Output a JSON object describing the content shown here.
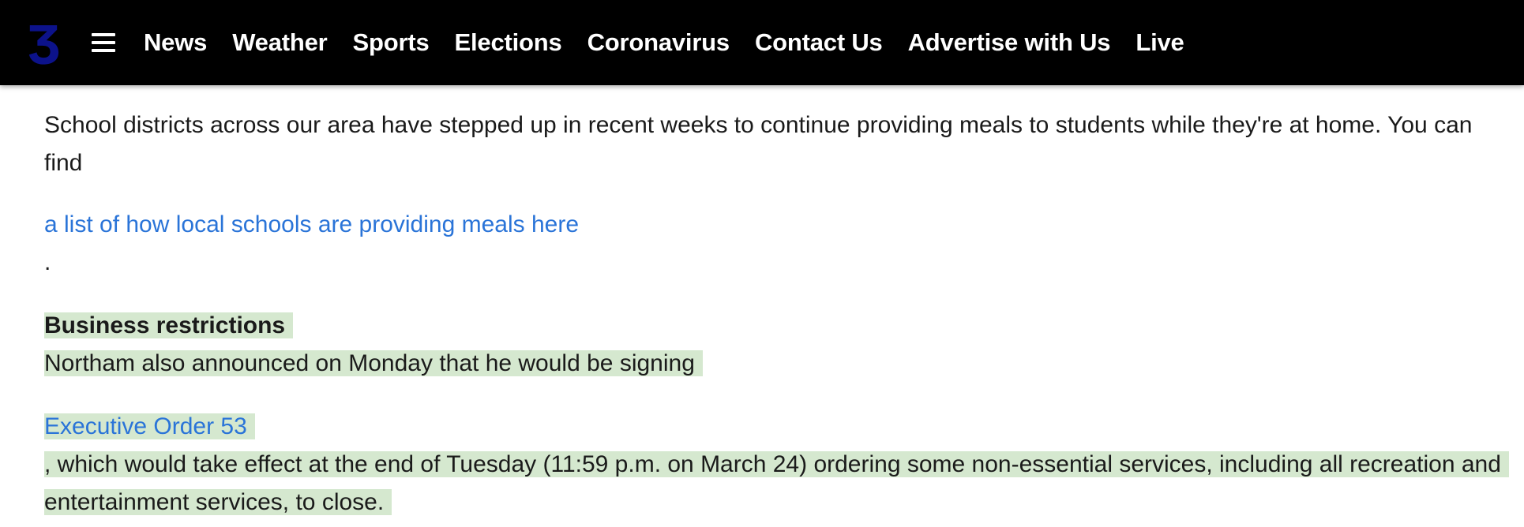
{
  "header": {
    "logo_text": "3",
    "logo_color": "#0c128a",
    "menu_icon": "hamburger-menu-icon",
    "nav": [
      {
        "label": "News"
      },
      {
        "label": "Weather"
      },
      {
        "label": "Sports"
      },
      {
        "label": "Elections"
      },
      {
        "label": "Coronavirus"
      },
      {
        "label": "Contact Us"
      },
      {
        "label": "Advertise with Us"
      },
      {
        "label": "Live"
      }
    ]
  },
  "article": {
    "para1": "School districts across our area have stepped up in recent weeks to continue providing meals to students while they're at home. You can find",
    "meals_link": "a list of how local schools are providing meals here",
    "period": ".",
    "section_heading": "Business restrictions",
    "para2": "Northam also announced on Monday that he would be signing",
    "eo_link": "Executive Order 53",
    "para3": ", which would take effect at the end of Tuesday (11:59 p.m. on March 24) ordering some non-essential services, including all recreation and entertainment services, to close."
  },
  "colors": {
    "header_bg": "#000000",
    "link": "#2a74d8",
    "highlight": "#d5e8cf",
    "text": "#1a1a1a"
  }
}
